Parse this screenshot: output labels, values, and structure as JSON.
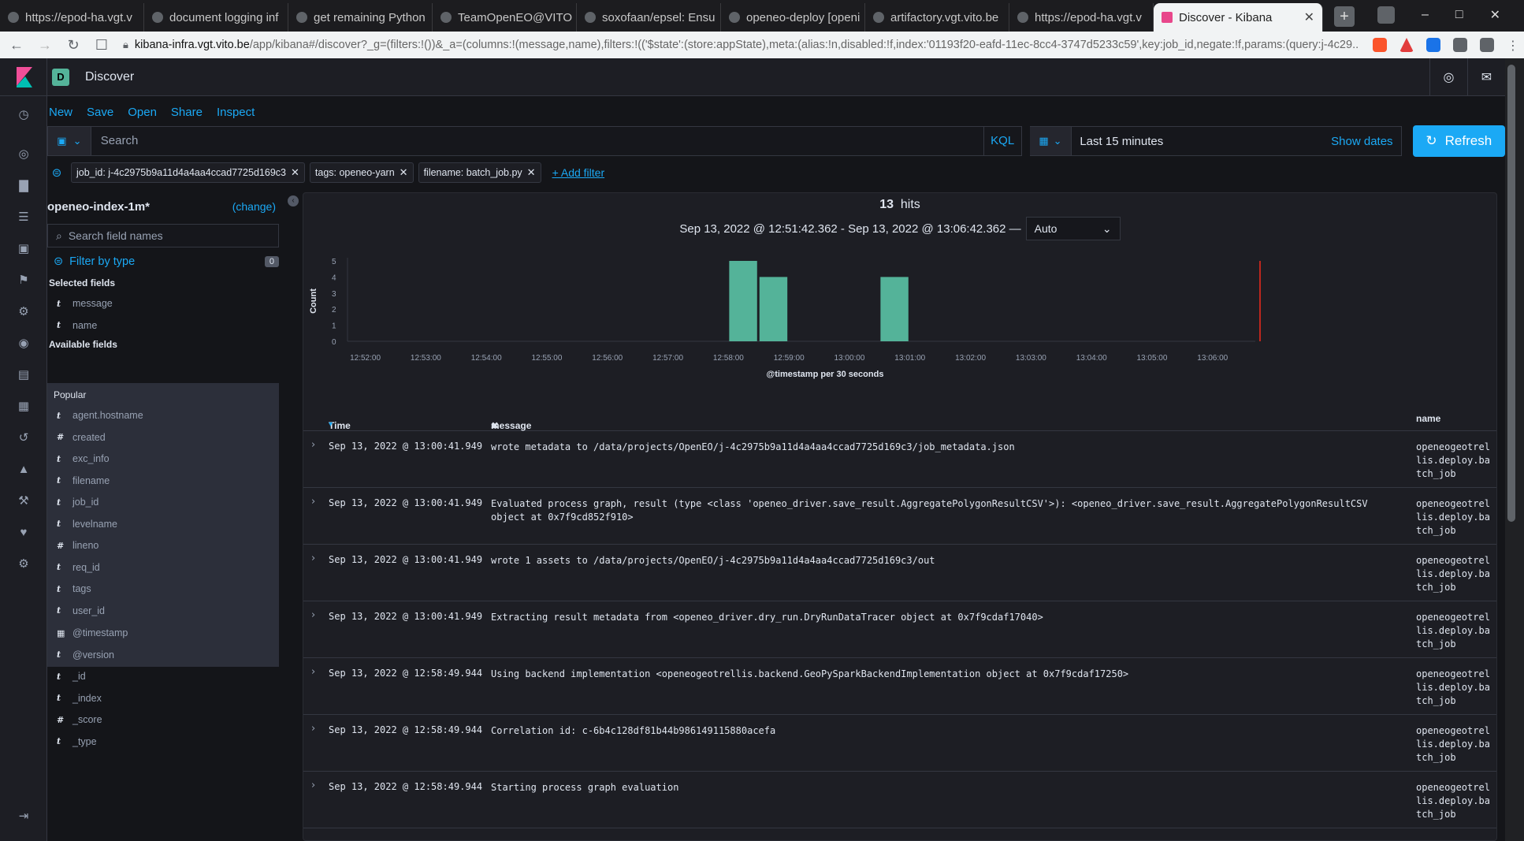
{
  "browser": {
    "tabs": [
      {
        "label": "https://epod-ha.vgt.v"
      },
      {
        "label": "document logging inf"
      },
      {
        "label": "get remaining Python"
      },
      {
        "label": "TeamOpenEO@VITO"
      },
      {
        "label": "soxofaan/epsel: Ensu"
      },
      {
        "label": "openeo-deploy [openi"
      },
      {
        "label": "artifactory.vgt.vito.be"
      },
      {
        "label": "https://epod-ha.vgt.v"
      },
      {
        "label": "Discover - Kibana"
      }
    ],
    "url_domain": "kibana-infra.vgt.vito.be",
    "url_rest": "/app/kibana#/discover?_g=(filters:!())&_a=(columns:!(message,name),filters:!(('$state':(store:appState),meta:(alias:!n,disabled:!f,index:'01193f20-eafd-11ec-8cc4-3747d5233c59',key:job_id,negate:!f,params:(query:j-4c29..."
  },
  "header": {
    "space": "D",
    "title": "Discover"
  },
  "topnav": {
    "new": "New",
    "save": "Save",
    "open": "Open",
    "share": "Share",
    "inspect": "Inspect"
  },
  "query": {
    "placeholder": "Search",
    "language": "KQL",
    "time_range": "Last 15 minutes",
    "show_dates": "Show dates",
    "refresh": "Refresh"
  },
  "filters": [
    {
      "label": "job_id: j-4c2975b9a11d4a4aa4ccad7725d169c3"
    },
    {
      "label": "tags: openeo-yarn"
    },
    {
      "label": "filename: batch_job.py"
    }
  ],
  "add_filter": "+ Add filter",
  "sidebar": {
    "index": "openeo-index-1m*",
    "change": "(change)",
    "search_placeholder": "Search field names",
    "filter_by_type": "Filter by type",
    "filter_count": "0",
    "selected_title": "Selected fields",
    "selected": [
      {
        "type": "t",
        "name": "message"
      },
      {
        "type": "t",
        "name": "name"
      }
    ],
    "available_title": "Available fields",
    "popular_title": "Popular",
    "popular": [
      {
        "type": "t",
        "name": "agent.hostname"
      },
      {
        "type": "#",
        "name": "created"
      },
      {
        "type": "t",
        "name": "exc_info"
      },
      {
        "type": "t",
        "name": "filename"
      },
      {
        "type": "t",
        "name": "job_id"
      },
      {
        "type": "t",
        "name": "levelname"
      },
      {
        "type": "#",
        "name": "lineno"
      },
      {
        "type": "t",
        "name": "req_id"
      },
      {
        "type": "t",
        "name": "tags"
      },
      {
        "type": "t",
        "name": "user_id"
      }
    ],
    "other": [
      {
        "type": "cal",
        "name": "@timestamp"
      },
      {
        "type": "t",
        "name": "@version"
      },
      {
        "type": "t",
        "name": "_id"
      },
      {
        "type": "t",
        "name": "_index"
      },
      {
        "type": "#",
        "name": "_score"
      },
      {
        "type": "t",
        "name": "_type"
      }
    ]
  },
  "results": {
    "hits_count": "13",
    "hits_label": "hits",
    "range": "Sep 13, 2022 @ 12:51:42.362 - Sep 13, 2022 @ 13:06:42.362 —",
    "interval": "Auto",
    "columns": {
      "time": "Time",
      "message": "message",
      "name": "name"
    },
    "rows": [
      {
        "time": "Sep 13, 2022 @ 13:00:41.949",
        "message": "wrote metadata to /data/projects/OpenEO/j-4c2975b9a11d4a4aa4ccad7725d169c3/job_metadata.json",
        "name": "openeogeotrellis.deploy.batch_job"
      },
      {
        "time": "Sep 13, 2022 @ 13:00:41.949",
        "message": "Evaluated process graph, result (type <class 'openeo_driver.save_result.AggregatePolygonResultCSV'>): <openeo_driver.save_result.AggregatePolygonResultCSV object at 0x7f9cd852f910>",
        "name": "openeogeotrellis.deploy.batch_job"
      },
      {
        "time": "Sep 13, 2022 @ 13:00:41.949",
        "message": "wrote 1 assets to /data/projects/OpenEO/j-4c2975b9a11d4a4aa4ccad7725d169c3/out",
        "name": "openeogeotrellis.deploy.batch_job"
      },
      {
        "time": "Sep 13, 2022 @ 13:00:41.949",
        "message": "Extracting result metadata from <openeo_driver.dry_run.DryRunDataTracer object at 0x7f9cdaf17040>",
        "name": "openeogeotrellis.deploy.batch_job"
      },
      {
        "time": "Sep 13, 2022 @ 12:58:49.944",
        "message": "Using backend implementation <openeogeotrellis.backend.GeoPySparkBackendImplementation object at 0x7f9cdaf17250>",
        "name": "openeogeotrellis.deploy.batch_job"
      },
      {
        "time": "Sep 13, 2022 @ 12:58:49.944",
        "message": "Correlation id: c-6b4c128df81b44b986149115880acefa",
        "name": "openeogeotrellis.deploy.batch_job"
      },
      {
        "time": "Sep 13, 2022 @ 12:58:49.944",
        "message": "Starting process graph evaluation",
        "name": "openeogeotrellis.deploy.batch_job"
      }
    ]
  },
  "chart_data": {
    "type": "bar",
    "xlabel": "@timestamp per 30 seconds",
    "ylabel": "Count",
    "ylim": [
      0,
      5
    ],
    "yticks": [
      "0",
      "1",
      "2",
      "3",
      "4",
      "5"
    ],
    "x_ticks": [
      "12:52:00",
      "12:53:00",
      "12:54:00",
      "12:55:00",
      "12:56:00",
      "12:57:00",
      "12:58:00",
      "12:59:00",
      "13:00:00",
      "13:01:00",
      "13:02:00",
      "13:03:00",
      "13:04:00",
      "13:05:00",
      "13:06:00"
    ],
    "bars": [
      {
        "x": "12:58:00",
        "value": 5
      },
      {
        "x": "12:58:30",
        "value": 4
      },
      {
        "x": "13:00:30",
        "value": 4
      }
    ],
    "color": "#54b399"
  }
}
